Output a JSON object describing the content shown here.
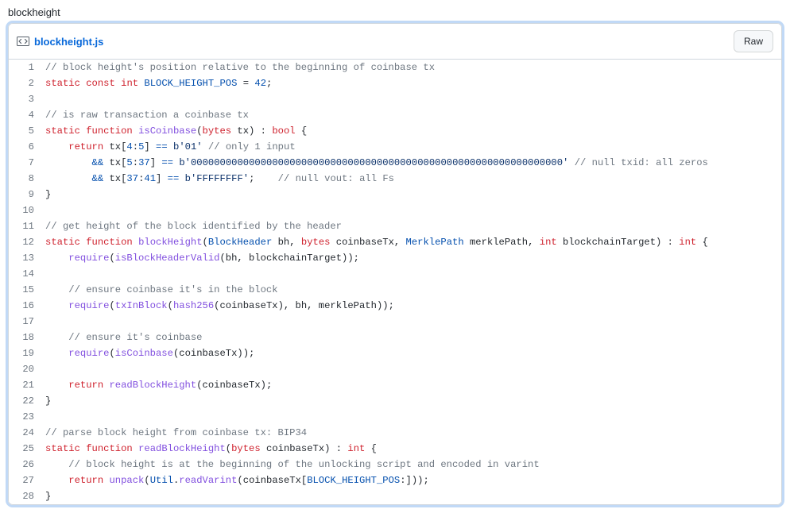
{
  "page": {
    "title": "blockheight"
  },
  "file": {
    "name": "blockheight.js",
    "raw_label": "Raw"
  },
  "code": {
    "lines": [
      [
        {
          "c": "c",
          "t": "// block height's position relative to the beginning of coinbase tx"
        }
      ],
      [
        {
          "c": "kw",
          "t": "static"
        },
        {
          "c": "pl",
          "t": " "
        },
        {
          "c": "kw",
          "t": "const"
        },
        {
          "c": "pl",
          "t": " "
        },
        {
          "c": "ty",
          "t": "int"
        },
        {
          "c": "pl",
          "t": " "
        },
        {
          "c": "cn",
          "t": "BLOCK_HEIGHT_POS"
        },
        {
          "c": "pl",
          "t": " = "
        },
        {
          "c": "nm",
          "t": "42"
        },
        {
          "c": "pl",
          "t": ";"
        }
      ],
      [],
      [
        {
          "c": "c",
          "t": "// is raw transaction a coinbase tx"
        }
      ],
      [
        {
          "c": "kw",
          "t": "static"
        },
        {
          "c": "pl",
          "t": " "
        },
        {
          "c": "kw",
          "t": "function"
        },
        {
          "c": "pl",
          "t": " "
        },
        {
          "c": "id",
          "t": "isCoinbase"
        },
        {
          "c": "pl",
          "t": "("
        },
        {
          "c": "ty",
          "t": "bytes"
        },
        {
          "c": "pl",
          "t": " tx) : "
        },
        {
          "c": "ty",
          "t": "bool"
        },
        {
          "c": "pl",
          "t": " {"
        }
      ],
      [
        {
          "c": "pl",
          "t": "    "
        },
        {
          "c": "kw",
          "t": "return"
        },
        {
          "c": "pl",
          "t": " tx["
        },
        {
          "c": "nm",
          "t": "4"
        },
        {
          "c": "pl",
          "t": ":"
        },
        {
          "c": "nm",
          "t": "5"
        },
        {
          "c": "pl",
          "t": "] "
        },
        {
          "c": "op",
          "t": "=="
        },
        {
          "c": "pl",
          "t": " "
        },
        {
          "c": "st",
          "t": "b'01'"
        },
        {
          "c": "pl",
          "t": " "
        },
        {
          "c": "c",
          "t": "// only 1 input"
        }
      ],
      [
        {
          "c": "pl",
          "t": "        "
        },
        {
          "c": "op",
          "t": "&&"
        },
        {
          "c": "pl",
          "t": " tx["
        },
        {
          "c": "nm",
          "t": "5"
        },
        {
          "c": "pl",
          "t": ":"
        },
        {
          "c": "nm",
          "t": "37"
        },
        {
          "c": "pl",
          "t": "] "
        },
        {
          "c": "op",
          "t": "=="
        },
        {
          "c": "pl",
          "t": " "
        },
        {
          "c": "st",
          "t": "b'0000000000000000000000000000000000000000000000000000000000000000'"
        },
        {
          "c": "pl",
          "t": " "
        },
        {
          "c": "c",
          "t": "// null txid: all zeros"
        }
      ],
      [
        {
          "c": "pl",
          "t": "        "
        },
        {
          "c": "op",
          "t": "&&"
        },
        {
          "c": "pl",
          "t": " tx["
        },
        {
          "c": "nm",
          "t": "37"
        },
        {
          "c": "pl",
          "t": ":"
        },
        {
          "c": "nm",
          "t": "41"
        },
        {
          "c": "pl",
          "t": "] "
        },
        {
          "c": "op",
          "t": "=="
        },
        {
          "c": "pl",
          "t": " "
        },
        {
          "c": "st",
          "t": "b'FFFFFFFF'"
        },
        {
          "c": "pl",
          "t": ";    "
        },
        {
          "c": "c",
          "t": "// null vout: all Fs"
        }
      ],
      [
        {
          "c": "pl",
          "t": "}"
        }
      ],
      [],
      [
        {
          "c": "c",
          "t": "// get height of the block identified by the header"
        }
      ],
      [
        {
          "c": "kw",
          "t": "static"
        },
        {
          "c": "pl",
          "t": " "
        },
        {
          "c": "kw",
          "t": "function"
        },
        {
          "c": "pl",
          "t": " "
        },
        {
          "c": "id",
          "t": "blockHeight"
        },
        {
          "c": "pl",
          "t": "("
        },
        {
          "c": "cn",
          "t": "BlockHeader"
        },
        {
          "c": "pl",
          "t": " bh, "
        },
        {
          "c": "ty",
          "t": "bytes"
        },
        {
          "c": "pl",
          "t": " coinbaseTx, "
        },
        {
          "c": "cn",
          "t": "MerklePath"
        },
        {
          "c": "pl",
          "t": " merklePath, "
        },
        {
          "c": "ty",
          "t": "int"
        },
        {
          "c": "pl",
          "t": " blockchainTarget) : "
        },
        {
          "c": "ty",
          "t": "int"
        },
        {
          "c": "pl",
          "t": " {"
        }
      ],
      [
        {
          "c": "pl",
          "t": "    "
        },
        {
          "c": "id",
          "t": "require"
        },
        {
          "c": "pl",
          "t": "("
        },
        {
          "c": "id",
          "t": "isBlockHeaderValid"
        },
        {
          "c": "pl",
          "t": "(bh, blockchainTarget));"
        }
      ],
      [],
      [
        {
          "c": "pl",
          "t": "    "
        },
        {
          "c": "c",
          "t": "// ensure coinbase it's in the block"
        }
      ],
      [
        {
          "c": "pl",
          "t": "    "
        },
        {
          "c": "id",
          "t": "require"
        },
        {
          "c": "pl",
          "t": "("
        },
        {
          "c": "id",
          "t": "txInBlock"
        },
        {
          "c": "pl",
          "t": "("
        },
        {
          "c": "id",
          "t": "hash256"
        },
        {
          "c": "pl",
          "t": "(coinbaseTx), bh, merklePath));"
        }
      ],
      [],
      [
        {
          "c": "pl",
          "t": "    "
        },
        {
          "c": "c",
          "t": "// ensure it's coinbase"
        }
      ],
      [
        {
          "c": "pl",
          "t": "    "
        },
        {
          "c": "id",
          "t": "require"
        },
        {
          "c": "pl",
          "t": "("
        },
        {
          "c": "id",
          "t": "isCoinbase"
        },
        {
          "c": "pl",
          "t": "(coinbaseTx));"
        }
      ],
      [],
      [
        {
          "c": "pl",
          "t": "    "
        },
        {
          "c": "kw",
          "t": "return"
        },
        {
          "c": "pl",
          "t": " "
        },
        {
          "c": "id",
          "t": "readBlockHeight"
        },
        {
          "c": "pl",
          "t": "(coinbaseTx);"
        }
      ],
      [
        {
          "c": "pl",
          "t": "}"
        }
      ],
      [],
      [
        {
          "c": "c",
          "t": "// parse block height from coinbase tx: BIP34"
        }
      ],
      [
        {
          "c": "kw",
          "t": "static"
        },
        {
          "c": "pl",
          "t": " "
        },
        {
          "c": "kw",
          "t": "function"
        },
        {
          "c": "pl",
          "t": " "
        },
        {
          "c": "id",
          "t": "readBlockHeight"
        },
        {
          "c": "pl",
          "t": "("
        },
        {
          "c": "ty",
          "t": "bytes"
        },
        {
          "c": "pl",
          "t": " coinbaseTx) : "
        },
        {
          "c": "ty",
          "t": "int"
        },
        {
          "c": "pl",
          "t": " {"
        }
      ],
      [
        {
          "c": "pl",
          "t": "    "
        },
        {
          "c": "c",
          "t": "// block height is at the beginning of the unlocking script and encoded in varint"
        }
      ],
      [
        {
          "c": "pl",
          "t": "    "
        },
        {
          "c": "kw",
          "t": "return"
        },
        {
          "c": "pl",
          "t": " "
        },
        {
          "c": "id",
          "t": "unpack"
        },
        {
          "c": "pl",
          "t": "("
        },
        {
          "c": "cn",
          "t": "Util"
        },
        {
          "c": "pl",
          "t": "."
        },
        {
          "c": "id",
          "t": "readVarint"
        },
        {
          "c": "pl",
          "t": "(coinbaseTx["
        },
        {
          "c": "cn",
          "t": "BLOCK_HEIGHT_POS"
        },
        {
          "c": "pl",
          "t": ":]));"
        }
      ],
      [
        {
          "c": "pl",
          "t": "}"
        }
      ]
    ]
  }
}
